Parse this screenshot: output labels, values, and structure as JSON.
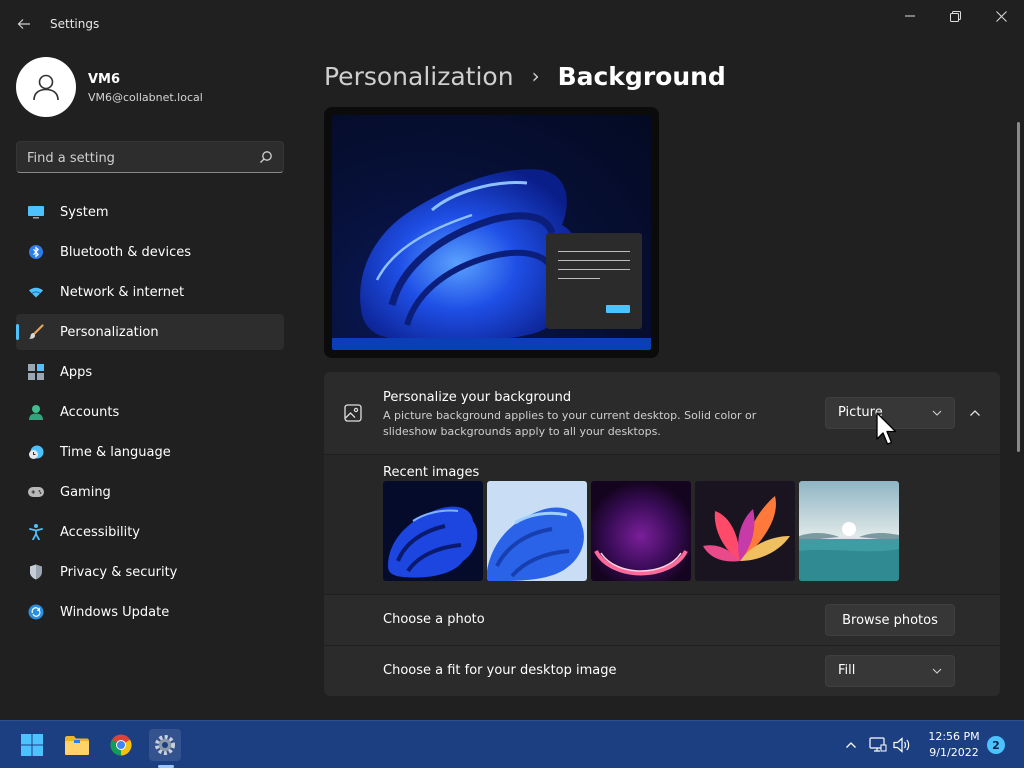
{
  "window": {
    "title": "Settings",
    "back_icon": "back-arrow-icon",
    "minimize_icon": "minimize-icon",
    "maximize_icon": "restore-icon",
    "close_icon": "close-icon"
  },
  "profile": {
    "name": "VM6",
    "email": "VM6@collabnet.local",
    "avatar_icon": "person-icon"
  },
  "search": {
    "placeholder": "Find a setting",
    "icon": "search-icon"
  },
  "sidebar": {
    "items": [
      {
        "label": "System",
        "icon": "monitor-icon",
        "active": false
      },
      {
        "label": "Bluetooth & devices",
        "icon": "bluetooth-icon",
        "active": false
      },
      {
        "label": "Network & internet",
        "icon": "wifi-icon",
        "active": false
      },
      {
        "label": "Personalization",
        "icon": "brush-icon",
        "active": true
      },
      {
        "label": "Apps",
        "icon": "apps-icon",
        "active": false
      },
      {
        "label": "Accounts",
        "icon": "accounts-icon",
        "active": false
      },
      {
        "label": "Time & language",
        "icon": "clock-globe-icon",
        "active": false
      },
      {
        "label": "Gaming",
        "icon": "gamepad-icon",
        "active": false
      },
      {
        "label": "Accessibility",
        "icon": "accessibility-icon",
        "active": false
      },
      {
        "label": "Privacy & security",
        "icon": "shield-icon",
        "active": false
      },
      {
        "label": "Windows Update",
        "icon": "update-icon",
        "active": false
      }
    ]
  },
  "breadcrumb": {
    "parent": "Personalization",
    "separator": "›",
    "current": "Background"
  },
  "background_card": {
    "title": "Personalize your background",
    "description": "A picture background applies to your current desktop. Solid color or slideshow backgrounds apply to all your desktops.",
    "type_value": "Picture",
    "icon": "image-icon",
    "collapse_icon": "chevron-up-icon"
  },
  "recent": {
    "label": "Recent images",
    "images": [
      {
        "name": "bloom-dark-thumbnail"
      },
      {
        "name": "bloom-light-thumbnail"
      },
      {
        "name": "glow-arc-thumbnail"
      },
      {
        "name": "ribbon-flower-thumbnail"
      },
      {
        "name": "lake-sunrise-thumbnail"
      }
    ]
  },
  "photo_row": {
    "label": "Choose a photo",
    "button": "Browse photos"
  },
  "fit_row": {
    "label": "Choose a fit for your desktop image",
    "value": "Fill"
  },
  "taskbar": {
    "apps": [
      {
        "name": "start-icon"
      },
      {
        "name": "file-explorer-icon"
      },
      {
        "name": "chrome-icon"
      },
      {
        "name": "settings-gear-icon",
        "active": true
      }
    ],
    "tray": [
      "chevron-up-icon",
      "network-icon",
      "volume-icon"
    ],
    "time": "12:56 PM",
    "date": "9/1/2022",
    "notifications": "2"
  },
  "colors": {
    "accent": "#4cc2ff",
    "background": "#202020",
    "card": "#2b2b2b",
    "taskbar": "#1c3f82"
  }
}
